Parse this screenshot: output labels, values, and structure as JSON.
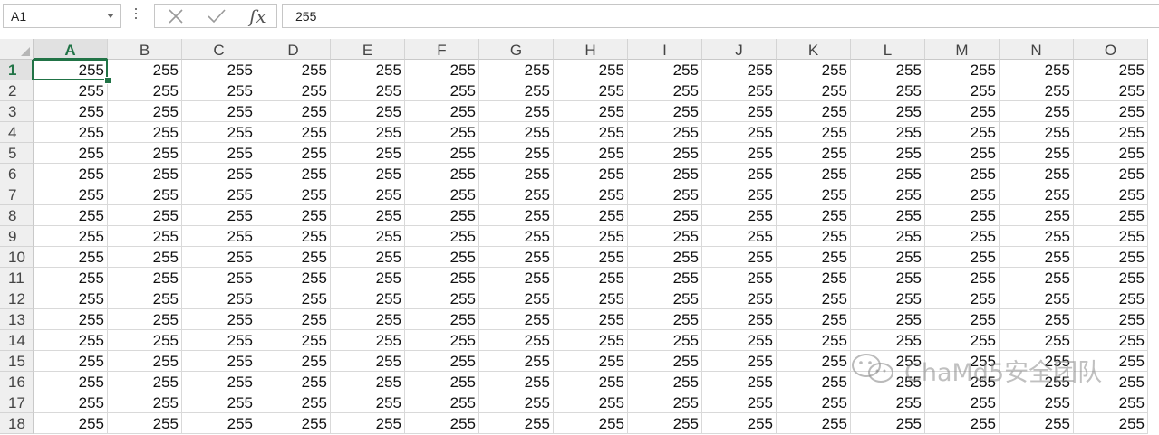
{
  "formula_bar": {
    "name_box": "A1",
    "fx_label": "fx",
    "formula_value": "255"
  },
  "sheet": {
    "selected_cell": "A1",
    "columns": [
      "A",
      "B",
      "C",
      "D",
      "E",
      "F",
      "G",
      "H",
      "I",
      "J",
      "K",
      "L",
      "M",
      "N",
      "O"
    ],
    "rows": [
      "1",
      "2",
      "3",
      "4",
      "5",
      "6",
      "7",
      "8",
      "9",
      "10",
      "11",
      "12",
      "13",
      "14",
      "15",
      "16",
      "17",
      "18"
    ],
    "cell_value": "255",
    "accent_color": "#217346"
  },
  "watermark": {
    "text": "ChaMd5安全团队"
  }
}
